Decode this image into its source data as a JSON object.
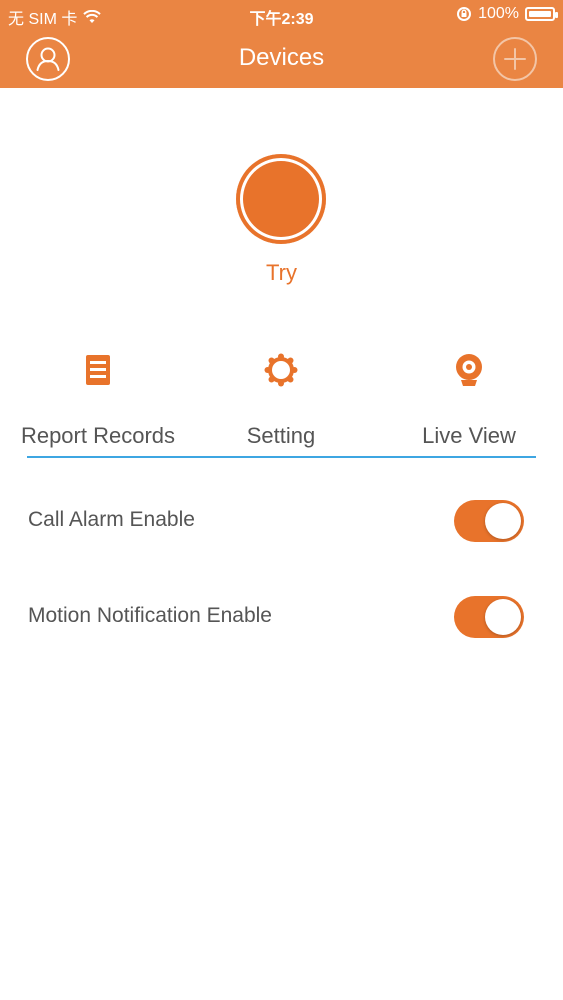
{
  "status_bar": {
    "carrier": "无 SIM 卡",
    "time": "下午2:39",
    "battery": "100%",
    "icons": [
      "wifi-icon",
      "rotation-lock-icon",
      "battery-icon"
    ]
  },
  "nav": {
    "title": "Devices",
    "left_icon": "profile-icon",
    "right_icon": "add-icon"
  },
  "device": {
    "name": "Try"
  },
  "tabs": [
    {
      "label": "Report Records",
      "icon": "report-records-icon"
    },
    {
      "label": "Setting",
      "icon": "setting-icon"
    },
    {
      "label": "Live View",
      "icon": "live-view-icon"
    }
  ],
  "settings": [
    {
      "label": "Call Alarm Enable",
      "enabled": true
    },
    {
      "label": "Motion Notification Enable",
      "enabled": true
    }
  ],
  "colors": {
    "accent": "#EA8543",
    "accent_dark": "#E8732B",
    "tab_underline": "#3EA6E2",
    "text_gray": "#555555"
  }
}
